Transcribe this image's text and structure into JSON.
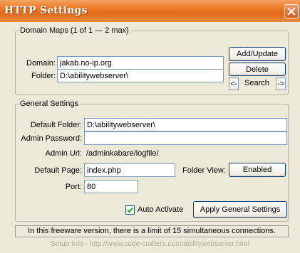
{
  "window": {
    "title": "HTTP Settings"
  },
  "domain_maps": {
    "legend": "Domain Maps (1 of 1 --- 2 max)",
    "domain_label": "Domain:",
    "domain_value": "jakab.no-ip.org",
    "folder_label": "Folder:",
    "folder_value": "D:\\abilitywebserver\\",
    "add_update_label": "Add/Update",
    "delete_label": "Delete",
    "search_prev": "<-",
    "search_label": "Search",
    "search_next": "->"
  },
  "general_settings": {
    "legend": "General Settings",
    "default_folder_label": "Default Folder:",
    "default_folder_value": "D:\\abilitywebserver\\",
    "admin_password_label": "Admin Password:",
    "admin_password_value": "",
    "admin_url_label": "Admin Url:",
    "admin_url_value": "/adminkabare/logfile/",
    "default_page_label": "Default Page:",
    "default_page_value": "index.php",
    "folder_view_label": "Folder View:",
    "folder_view_value": "Enabled",
    "port_label": "Port:",
    "port_value": "80",
    "auto_activate_label": "Auto Activate",
    "auto_activate_checked": true,
    "apply_label": "Apply General Settings"
  },
  "notice": "In this freeware version, there is a limit of 15 simultaneous connections.",
  "footer": "Setup Info - http://www.code-crafters.com/abilitywebserver.html"
}
